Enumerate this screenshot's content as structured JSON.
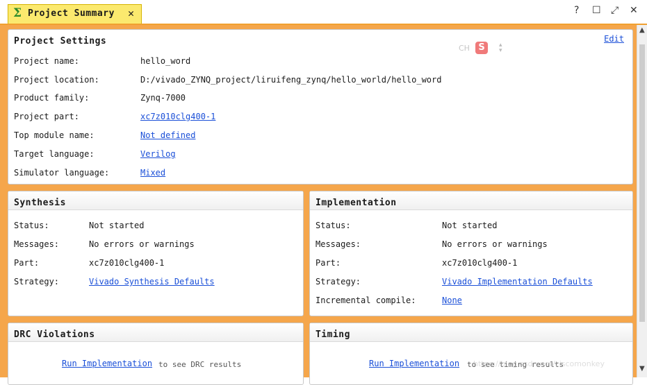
{
  "tab": {
    "icon": "Σ",
    "title": "Project Summary",
    "close": "✕"
  },
  "window_controls": {
    "help": "?",
    "maximize": "☐",
    "float": "⤢",
    "close": "✕"
  },
  "project_settings": {
    "title": "Project Settings",
    "edit_link": "Edit",
    "rows": [
      {
        "label": "Project name:",
        "value": "hello_word"
      },
      {
        "label": "Project location:",
        "value": "D:/vivado_ZYNQ_project/liruifeng_zynq/hello_world/hello_word"
      },
      {
        "label": "Product family:",
        "value": "Zynq-7000"
      },
      {
        "label": "Project part:",
        "value": "xc7z010clg400-1"
      },
      {
        "label": "Top module name:",
        "value": "Not defined"
      },
      {
        "label": "Target language:",
        "value": "Verilog"
      },
      {
        "label": "Simulator language:",
        "value": "Mixed"
      }
    ]
  },
  "ime": {
    "mode": "CH",
    "logo": "S"
  },
  "synthesis": {
    "title": "Synthesis",
    "rows": [
      {
        "label": "Status:",
        "value": "Not started"
      },
      {
        "label": "Messages:",
        "value": "No errors or warnings"
      },
      {
        "label": "Part:",
        "value": "xc7z010clg400-1"
      },
      {
        "label": "Strategy:",
        "value": "Vivado Synthesis Defaults"
      }
    ]
  },
  "implementation": {
    "title": "Implementation",
    "rows": [
      {
        "label": "Status:",
        "value": "Not started"
      },
      {
        "label": "Messages:",
        "value": "No errors or warnings"
      },
      {
        "label": "Part:",
        "value": "xc7z010clg400-1"
      },
      {
        "label": "Strategy:",
        "value": "Vivado Implementation Defaults"
      },
      {
        "label": "Incremental compile:",
        "value": "None"
      }
    ]
  },
  "drc": {
    "title": "DRC Violations",
    "link": "Run Implementation",
    "suffix": "to see DRC results"
  },
  "timing": {
    "title": "Timing",
    "link": "Run Implementation",
    "suffix": "to see timing results",
    "watermark": "https://blog.csdn.net/ciscomonkey"
  }
}
